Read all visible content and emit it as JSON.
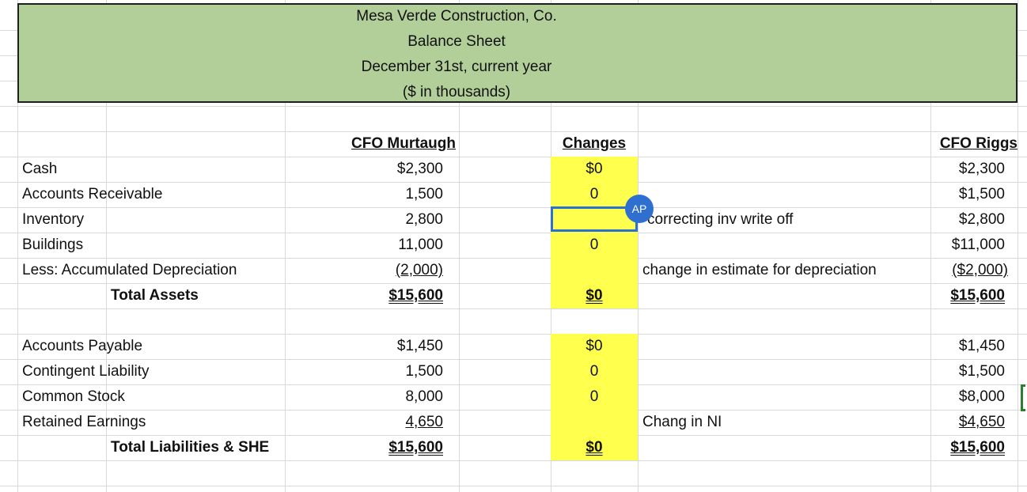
{
  "header": {
    "company": "Mesa Verde Construction, Co.",
    "statement": "Balance Sheet",
    "date": "December 31st, current year",
    "units": "($ in thousands)"
  },
  "columns": {
    "murtaugh": "CFO Murtaugh",
    "changes": "Changes",
    "riggs": "CFO Riggs"
  },
  "assets": [
    {
      "label": "Cash",
      "murtaugh": "$2,300",
      "change": "$0",
      "note": "",
      "riggs": "$2,300"
    },
    {
      "label": "Accounts Receivable",
      "murtaugh": "1,500",
      "change": "0",
      "note": "",
      "riggs": "$1,500"
    },
    {
      "label": "Inventory",
      "murtaugh": "2,800",
      "change": "",
      "note": "correcting inv write off",
      "riggs": "$2,800"
    },
    {
      "label": "Buildings",
      "murtaugh": "11,000",
      "change": "0",
      "note": "",
      "riggs": "$11,000"
    },
    {
      "label": "Less: Accumulated Depreciation",
      "murtaugh": "(2,000)",
      "change": "",
      "note": "change in estimate for depreciation",
      "riggs": "($2,000)"
    }
  ],
  "total_assets": {
    "label": "Total Assets",
    "murtaugh": "$15,600",
    "change": "$0",
    "riggs": "$15,600"
  },
  "liabilities": [
    {
      "label": "Accounts Payable",
      "murtaugh": "$1,450",
      "change": "$0",
      "note": "",
      "riggs": "$1,450"
    },
    {
      "label": "Contingent Liability",
      "murtaugh": "1,500",
      "change": "0",
      "note": "",
      "riggs": "$1,500"
    },
    {
      "label": "Common Stock",
      "murtaugh": "8,000",
      "change": "0",
      "note": "",
      "riggs": "$8,000"
    },
    {
      "label": "Retained Earnings",
      "murtaugh": "4,650",
      "change": "",
      "note": "Chang in NI",
      "riggs": "$4,650"
    }
  ],
  "total_liabilities": {
    "label": "Total Liabilities & SHE",
    "murtaugh": "$15,600",
    "change": "$0",
    "riggs": "$15,600"
  },
  "collaborator": {
    "initials": "AP"
  },
  "colors": {
    "header_fill": "#b3cf99",
    "highlight": "#ffff4d",
    "selection": "#2f6fd0"
  }
}
